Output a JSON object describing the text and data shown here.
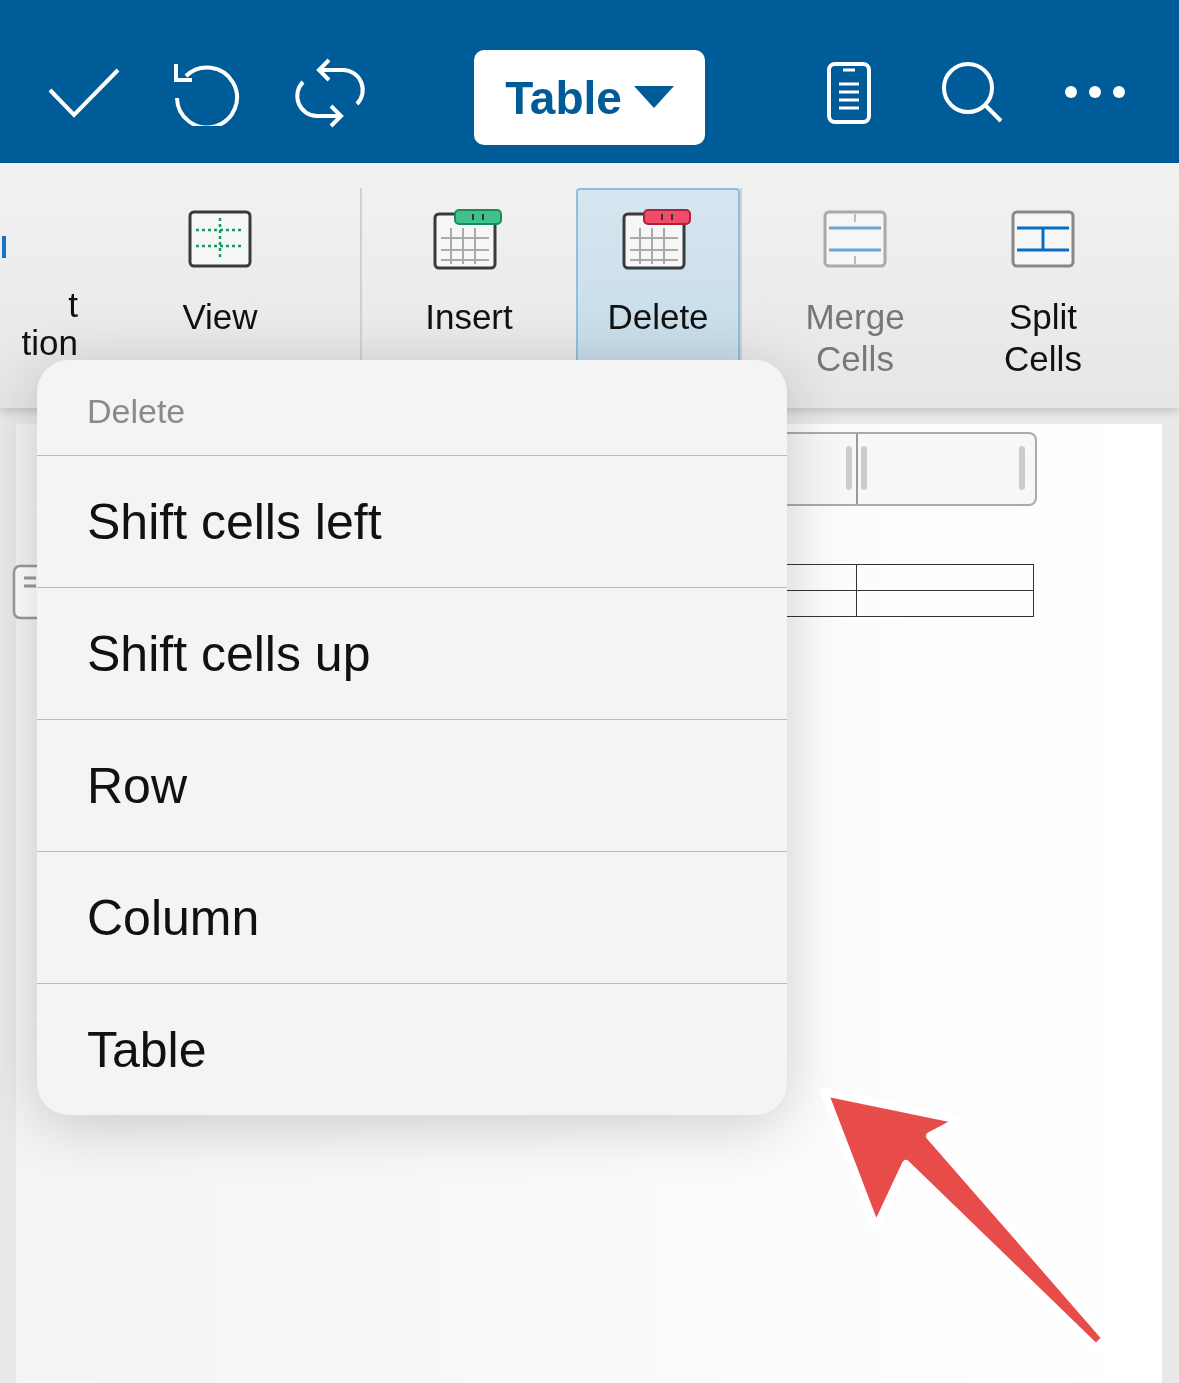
{
  "toolbar": {
    "title": "Table"
  },
  "ribbon": {
    "items": [
      {
        "kind": "partial",
        "lines": [
          "t",
          "tion"
        ],
        "selected": false,
        "disabled": false
      },
      {
        "kind": "gridlines",
        "lines": [
          "View"
        ],
        "selected": false,
        "disabled": false
      },
      {
        "kind": "insert",
        "lines": [
          "Insert"
        ],
        "selected": false,
        "disabled": false
      },
      {
        "kind": "delete",
        "lines": [
          "Delete"
        ],
        "selected": true,
        "disabled": false
      },
      {
        "kind": "merge",
        "lines": [
          "Merge",
          "Cells"
        ],
        "selected": false,
        "disabled": true
      },
      {
        "kind": "split",
        "lines": [
          "Split",
          "Cells"
        ],
        "selected": false,
        "disabled": false
      }
    ]
  },
  "menu": {
    "header": "Delete",
    "items": [
      {
        "label": "Shift cells left"
      },
      {
        "label": "Shift cells up"
      },
      {
        "label": "Row"
      },
      {
        "label": "Column"
      },
      {
        "label": "Table"
      }
    ]
  }
}
